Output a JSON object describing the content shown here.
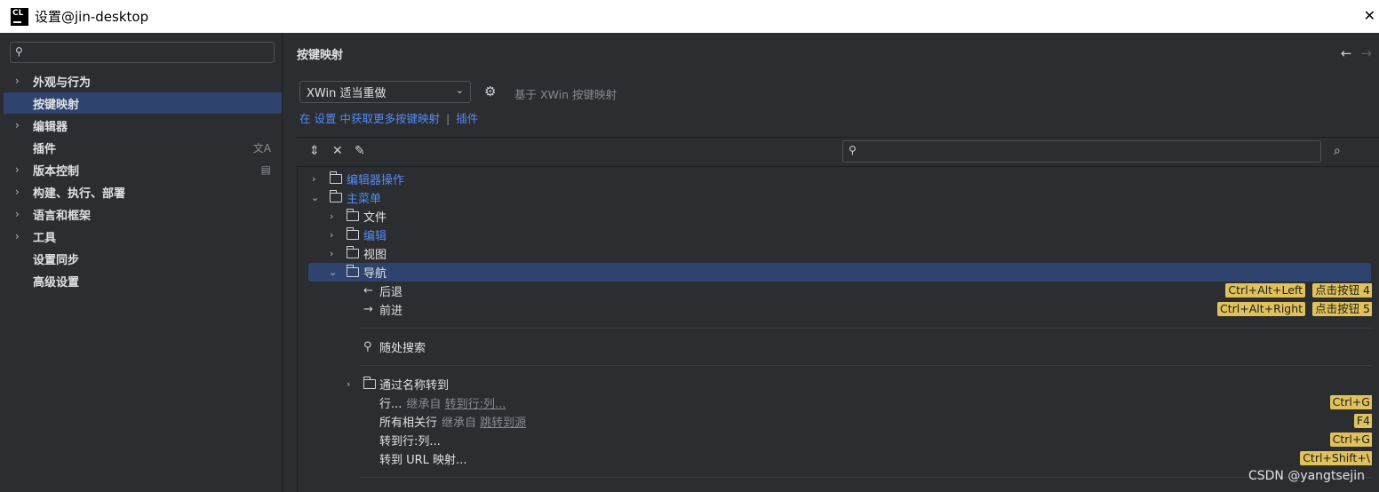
{
  "window": {
    "title": "设置@jin-desktop",
    "logo_text": "CL"
  },
  "sidebar": {
    "search_placeholder": "",
    "items": [
      {
        "label": "外观与行为",
        "expandable": true
      },
      {
        "label": "按键映射",
        "expandable": false,
        "selected": true
      },
      {
        "label": "编辑器",
        "expandable": true
      },
      {
        "label": "插件",
        "expandable": false
      },
      {
        "label": "版本控制",
        "expandable": true
      },
      {
        "label": "构建、执行、部署",
        "expandable": true
      },
      {
        "label": "语言和框架",
        "expandable": true
      },
      {
        "label": "工具",
        "expandable": true
      },
      {
        "label": "设置同步",
        "expandable": false
      },
      {
        "label": "高级设置",
        "expandable": false
      }
    ]
  },
  "main": {
    "title": "按键映射",
    "scheme": {
      "selected": "XWin 适当重做"
    },
    "based_on": "基于 XWin 按键映射",
    "get_more": {
      "prefix": "在",
      "settings_link": "设置",
      "middle": "中获取更多按键映射",
      "sep": "|",
      "plugins_link": "插件"
    },
    "search_placeholder": "",
    "tree": [
      {
        "label": "编辑器操作",
        "type": "folder",
        "level": 0,
        "expanded": false,
        "blue": true
      },
      {
        "label": "主菜单",
        "type": "folder",
        "level": 0,
        "expanded": true,
        "blue": true
      },
      {
        "label": "文件",
        "type": "folder",
        "level": 1,
        "expanded": false
      },
      {
        "label": "编辑",
        "type": "folder",
        "level": 1,
        "expanded": false,
        "blue": true
      },
      {
        "label": "视图",
        "type": "folder",
        "level": 1,
        "expanded": false
      },
      {
        "label": "导航",
        "type": "folder",
        "level": 1,
        "expanded": true,
        "selected": true
      },
      {
        "label": "后退",
        "type": "action",
        "icon": "arrow-left-icon",
        "shortcuts": [
          "Ctrl+Alt+Left",
          "点击按钮 4"
        ]
      },
      {
        "label": "前进",
        "type": "action",
        "icon": "arrow-right-icon",
        "shortcuts": [
          "Ctrl+Alt+Right",
          "点击按钮 5"
        ]
      },
      {
        "label": "随处搜索",
        "type": "action",
        "icon": "search-icon",
        "shortcuts": []
      },
      {
        "label": "通过名称转到",
        "type": "folder",
        "level": 2,
        "expanded": false
      },
      {
        "label": "行...",
        "type": "action",
        "inherit_prefix": "继承自",
        "inherit_link": "转到行:列...",
        "shortcuts": [
          "Ctrl+G"
        ]
      },
      {
        "label": "所有相关行",
        "type": "action",
        "inherit_prefix": "继承自",
        "inherit_link": "跳转到源",
        "shortcuts": [
          "F4"
        ]
      },
      {
        "label": "转到行:列...",
        "type": "action",
        "shortcuts": [
          "Ctrl+G"
        ]
      },
      {
        "label": "转到 URL 映射...",
        "type": "action",
        "shortcuts": [
          "Ctrl+Shift+\\"
        ]
      }
    ]
  },
  "watermark": "CSDN @yangtsejin",
  "colors": {
    "background": "#2b2d30",
    "selection": "#2e436e",
    "link": "#548af7",
    "shortcut_badge": "#e0c15a"
  }
}
